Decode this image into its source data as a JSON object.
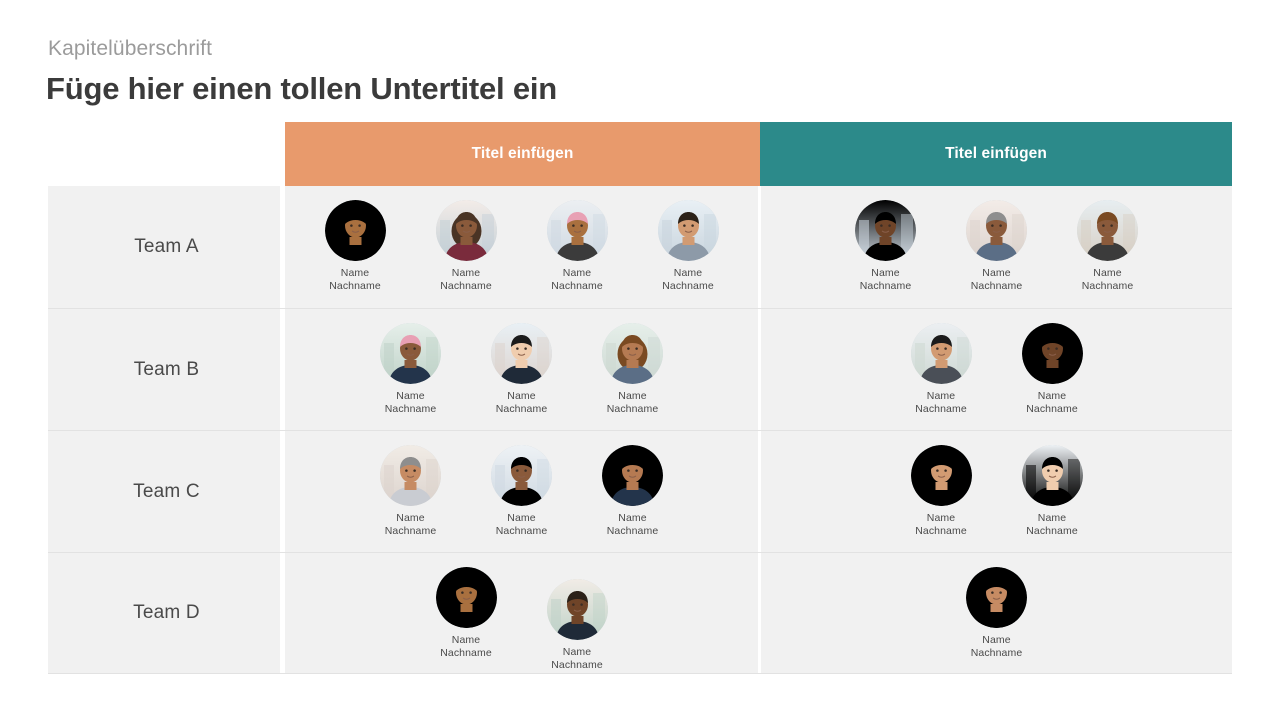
{
  "slide": {
    "kicker": "Kapitelüberschrift",
    "title": "Füge hier einen tollen Untertitel ein"
  },
  "colors": {
    "column_a_header_bg": "#E89A6C",
    "column_b_header_bg": "#2C8A8A",
    "row_bg": "#F1F1F1",
    "row_border": "#E2E2E2",
    "header_text": "#FFFFFF",
    "body_text": "#4A4A4A",
    "kicker_text": "#9B9B9B",
    "title_text": "#3B3B3B"
  },
  "table": {
    "column_headers": [
      {
        "label": "",
        "kind": "spacer"
      },
      {
        "label": "Titel einfügen",
        "kind": "orange"
      },
      {
        "label": "Titel einfügen",
        "kind": "teal"
      }
    ],
    "rows": [
      {
        "label": "Team A",
        "column_a": [
          {
            "first": "Name",
            "last": "Nachname",
            "photo": "businesswoman-dark-suit-city"
          },
          {
            "first": "Name",
            "last": "Nachname",
            "photo": "man-green-sweater-arms-crossed"
          },
          {
            "first": "Name",
            "last": "Nachname",
            "photo": "woman-red-hair-green-top"
          },
          {
            "first": "Name",
            "last": "Nachname",
            "photo": "man-plaid-shirt-park"
          }
        ],
        "column_b": [
          {
            "first": "Name",
            "last": "Nachname",
            "photo": "man-glasses-library-smiling"
          },
          {
            "first": "Name",
            "last": "Nachname",
            "photo": "woman-pink-hair-denim"
          },
          {
            "first": "Name",
            "last": "Nachname",
            "photo": "man-glasses-backpack-street"
          }
        ]
      },
      {
        "label": "Team B",
        "column_a": [
          {
            "first": "Name",
            "last": "Nachname",
            "photo": "man-navy-blazer-bridge"
          },
          {
            "first": "Name",
            "last": "Nachname",
            "photo": "woman-curly-hair-white-blazer"
          },
          {
            "first": "Name",
            "last": "Nachname",
            "photo": "senior-man-grey-suit"
          }
        ],
        "column_b": [
          {
            "first": "Name",
            "last": "Nachname",
            "photo": "woman-updo-blue-blouse"
          },
          {
            "first": "Name",
            "last": "Nachname",
            "photo": "woman-glasses-thumbs-up-lab"
          }
        ]
      },
      {
        "label": "Team C",
        "column_a": [
          {
            "first": "Name",
            "last": "Nachname",
            "photo": "woman-blanket-beach"
          },
          {
            "first": "Name",
            "last": "Nachname",
            "photo": "man-maroon-suit-tie"
          },
          {
            "first": "Name",
            "last": "Nachname",
            "photo": "senior-woman-floral-blouse"
          }
        ],
        "column_b": [
          {
            "first": "Name",
            "last": "Nachname",
            "photo": "woman-grey-suit-yellow-top"
          },
          {
            "first": "Name",
            "last": "Nachname",
            "photo": "woman-navy-blazer-city"
          }
        ]
      },
      {
        "label": "Team D",
        "column_a": [
          {
            "first": "Name",
            "last": "Nachname",
            "photo": "man-leather-jacket-outdoors"
          },
          {
            "first": "Name",
            "last": "Nachname",
            "photo": "man-hoodie-city-smiling",
            "offset": true
          }
        ],
        "column_b": [
          {
            "first": "Name",
            "last": "Nachname",
            "photo": "man-curly-hair-white-tshirt"
          }
        ]
      }
    ]
  }
}
